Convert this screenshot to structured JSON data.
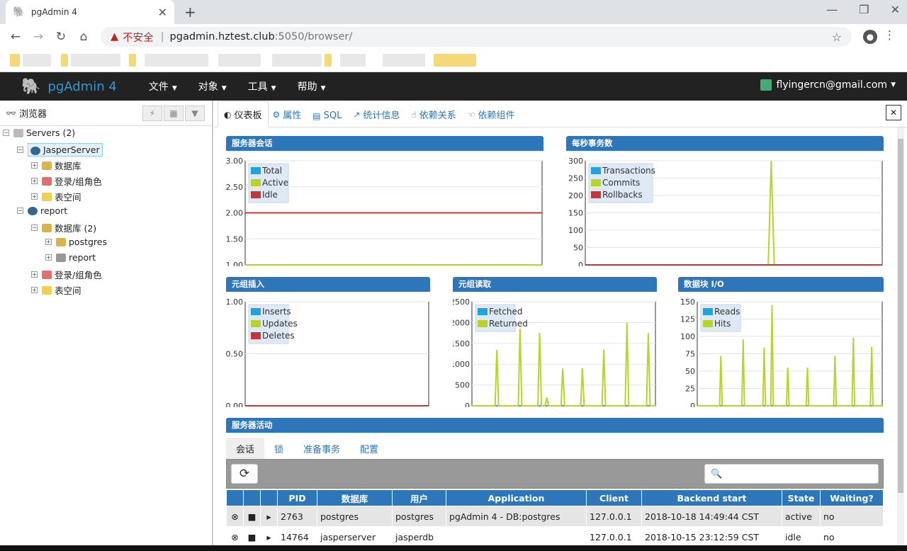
{
  "browser": {
    "tab_title": "pgAdmin 4",
    "new_tab": "+",
    "tab_close": "✕",
    "insecure": "不安全",
    "url_host": "pgadmin.hztest.club",
    "url_path": ":5050/browser/"
  },
  "app": {
    "brand": "pgAdmin 4",
    "menus": [
      "文件",
      "对象",
      "工具",
      "帮助"
    ],
    "user": "flyingercn@gmail.com"
  },
  "left": {
    "title": "浏览器",
    "tree": [
      {
        "label": "Servers (2)"
      },
      {
        "label": "JasperServer"
      },
      {
        "label": "数据库"
      },
      {
        "label": "登录/组角色"
      },
      {
        "label": "表空间"
      },
      {
        "label": "report"
      },
      {
        "label": "数据库 (2)"
      },
      {
        "label": "postgres"
      },
      {
        "label": "report"
      },
      {
        "label": "登录/组角色"
      },
      {
        "label": "表空间"
      }
    ]
  },
  "right": {
    "tabs": [
      "仪表板",
      "属性",
      "SQL",
      "统计信息",
      "依赖关系",
      "依赖组件"
    ],
    "close_icon": "✕",
    "subtabs": [
      "会话",
      "锁",
      "准备事务",
      "配置"
    ]
  },
  "colors": {
    "blue": "#2c76b9",
    "series_blue": "#23a3dd",
    "series_green": "#b8d42a",
    "series_red": "#c0393b"
  },
  "chart_data": [
    {
      "type": "line",
      "title": "服务器会话",
      "ylim": [
        1.0,
        3.0
      ],
      "yticks": [
        "3.00",
        "2.50",
        "2.00",
        "1.50",
        "1.00"
      ],
      "series": [
        {
          "name": "Total",
          "color": "#23a3dd",
          "values": [
            2,
            2,
            2,
            2,
            2,
            2,
            2,
            2,
            2,
            2,
            2,
            2,
            2,
            2,
            2,
            2,
            2,
            2,
            2,
            2
          ]
        },
        {
          "name": "Active",
          "color": "#b8d42a",
          "values": [
            1,
            1,
            1,
            1,
            1,
            1,
            1,
            1,
            1,
            1,
            1,
            1,
            1,
            1,
            1,
            1,
            1,
            1,
            1,
            1
          ]
        },
        {
          "name": "Idle",
          "color": "#c0393b",
          "values": [
            2,
            2,
            2,
            2,
            2,
            2,
            2,
            2,
            2,
            2,
            2,
            2,
            2,
            2,
            2,
            2,
            2,
            2,
            2,
            2
          ]
        }
      ]
    },
    {
      "type": "line",
      "title": "每秒事务数",
      "ylim": [
        0,
        300
      ],
      "yticks": [
        "300",
        "250",
        "200",
        "150",
        "100",
        "50",
        "0"
      ],
      "series": [
        {
          "name": "Transactions",
          "color": "#23a3dd",
          "values": [
            0,
            0,
            0,
            0,
            0,
            0,
            0,
            0,
            0,
            0,
            0,
            0,
            0,
            0,
            0,
            0,
            0,
            0,
            0,
            0,
            0,
            0,
            0,
            0,
            0,
            0,
            0,
            0,
            0,
            0
          ]
        },
        {
          "name": "Commits",
          "color": "#b8d42a",
          "values": [
            0,
            0,
            0,
            0,
            0,
            0,
            0,
            0,
            0,
            0,
            0,
            0,
            0,
            0,
            0,
            0,
            0,
            0,
            0,
            0,
            0,
            0,
            0,
            0,
            0,
            0,
            0,
            0,
            0,
            0,
            0,
            0,
            0,
            0,
            0,
            0,
            0,
            0,
            0,
            0,
            0,
            0,
            0,
            0,
            0,
            0,
            0,
            0,
            0,
            0,
            0,
            0,
            0,
            0,
            0,
            0,
            0,
            0,
            0,
            0,
            0,
            0,
            300,
            0,
            0,
            0,
            0,
            0,
            0,
            0,
            0,
            0,
            0,
            0,
            0,
            0,
            0,
            0,
            0,
            0,
            0,
            0,
            0,
            0,
            0,
            0,
            0,
            0,
            0,
            0,
            0,
            0,
            0,
            0,
            0,
            0,
            0,
            0,
            0,
            0
          ]
        },
        {
          "name": "Rollbacks",
          "color": "#c0393b",
          "values": [
            0,
            0,
            0,
            0,
            0,
            0,
            0,
            0,
            0,
            0
          ]
        }
      ]
    },
    {
      "type": "line",
      "title": "元组插入",
      "ylim": [
        0,
        1
      ],
      "yticks": [
        "1.00",
        "0.50",
        "0.00"
      ],
      "series": [
        {
          "name": "Inserts",
          "color": "#23a3dd",
          "values": [
            0,
            0,
            0,
            0,
            0,
            0,
            0,
            0,
            0,
            0
          ]
        },
        {
          "name": "Updates",
          "color": "#b8d42a",
          "values": [
            0,
            0,
            0,
            0,
            0,
            0,
            0,
            0,
            0,
            0
          ]
        },
        {
          "name": "Deletes",
          "color": "#c0393b",
          "values": [
            0,
            0,
            0,
            0,
            0,
            0,
            0,
            0,
            0,
            0
          ]
        }
      ]
    },
    {
      "type": "line",
      "title": "元组读取",
      "ylim": [
        0,
        2500
      ],
      "yticks": [
        "2500",
        "2000",
        "1500",
        "1000",
        "500",
        "0"
      ],
      "series": [
        {
          "name": "Fetched",
          "color": "#23a3dd",
          "values": [
            0,
            0,
            0,
            0,
            0,
            0,
            0,
            0,
            0,
            0
          ]
        },
        {
          "name": "Returned",
          "color": "#b8d42a",
          "values": [
            0,
            0,
            0,
            0,
            0,
            0,
            0,
            0,
            0,
            0,
            0,
            0,
            0,
            0,
            1350,
            0,
            0,
            0,
            0,
            0,
            0,
            0,
            0,
            0,
            0,
            0,
            0,
            1850,
            0,
            0,
            0,
            0,
            0,
            0,
            0,
            0,
            0,
            0,
            1750,
            0,
            0,
            0,
            200,
            0,
            0,
            0,
            0,
            0,
            0,
            0,
            0,
            900,
            0,
            0,
            0,
            0,
            0,
            0,
            0,
            0,
            0,
            0,
            900,
            0,
            0,
            0,
            0,
            0,
            0,
            0,
            0,
            0,
            0,
            0,
            1350,
            0,
            0,
            0,
            0,
            0,
            0,
            0,
            0,
            0,
            0,
            0,
            0,
            2000,
            0,
            0,
            0,
            0,
            0,
            0,
            0,
            0,
            0,
            0,
            0,
            1750,
            0,
            0,
            0,
            0
          ]
        }
      ]
    },
    {
      "type": "line",
      "title": "数据块 I/O",
      "ylim": [
        0,
        150
      ],
      "yticks": [
        "150",
        "125",
        "100",
        "75",
        "50",
        "25",
        "0"
      ],
      "series": [
        {
          "name": "Reads",
          "color": "#23a3dd",
          "values": [
            0,
            0,
            0,
            0,
            0,
            0,
            0,
            0,
            0,
            0
          ]
        },
        {
          "name": "Hits",
          "color": "#b8d42a",
          "values": [
            0,
            0,
            0,
            0,
            0,
            0,
            0,
            0,
            0,
            0,
            0,
            0,
            0,
            0,
            0,
            0,
            0,
            0,
            72,
            0,
            0,
            0,
            0,
            0,
            0,
            0,
            0,
            0,
            0,
            0,
            0,
            0,
            0,
            0,
            0,
            96,
            0,
            0,
            0,
            0,
            0,
            0,
            0,
            0,
            0,
            0,
            0,
            0,
            0,
            0,
            0,
            84,
            0,
            0,
            0,
            0,
            0,
            145,
            0,
            0,
            0,
            0,
            0,
            0,
            0,
            0,
            0,
            0,
            0,
            55,
            0,
            0,
            0,
            0,
            0,
            0,
            0,
            0,
            0,
            0,
            0,
            0,
            0,
            0,
            55,
            0,
            0,
            0,
            0,
            0,
            0,
            0,
            0,
            0,
            0,
            0,
            0,
            0,
            0,
            0,
            0,
            0,
            0,
            0,
            0,
            72,
            0,
            0,
            0,
            0,
            0,
            0,
            0,
            0,
            0,
            0,
            0,
            0,
            0,
            98,
            0,
            0,
            0,
            0,
            0,
            0,
            0,
            0,
            0,
            0,
            0,
            0,
            0,
            85,
            0,
            0,
            0,
            0,
            0,
            0,
            0,
            0
          ]
        }
      ]
    }
  ],
  "activity": {
    "title": "服务器活动",
    "columns": [
      "",
      "",
      "",
      "PID",
      "数据库",
      "用户",
      "Application",
      "Client",
      "Backend start",
      "State",
      "Waiting?"
    ],
    "rows": [
      {
        "pid": "2763",
        "db": "postgres",
        "user": "postgres",
        "app": "pgAdmin 4 - DB:postgres",
        "client": "127.0.0.1",
        "start": "2018-10-18 14:49:44 CST",
        "state": "active",
        "wait": "no"
      },
      {
        "pid": "14764",
        "db": "jasperserver",
        "user": "jasperdb",
        "app": "",
        "client": "127.0.0.1",
        "start": "2018-10-15 23:12:59 CST",
        "state": "idle",
        "wait": "no"
      }
    ]
  }
}
